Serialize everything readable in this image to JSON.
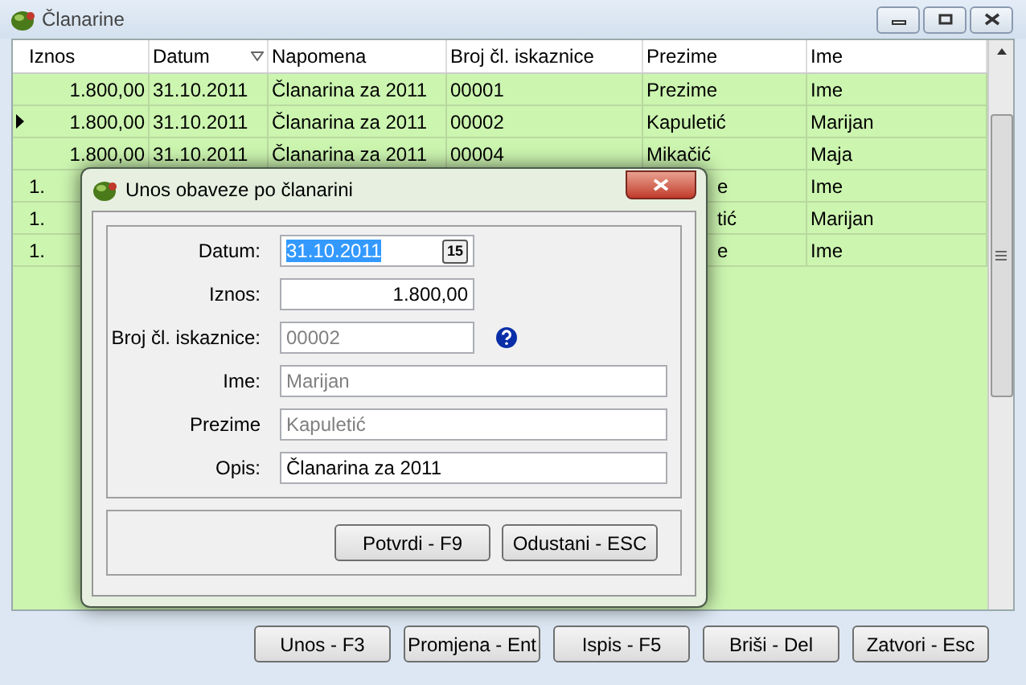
{
  "window": {
    "title": "Članarine"
  },
  "table": {
    "columns": [
      {
        "label": "Iznos",
        "sorted": false
      },
      {
        "label": "Datum",
        "sorted": true
      },
      {
        "label": "Napomena",
        "sorted": false
      },
      {
        "label": "Broj čl. iskaznice",
        "sorted": false
      },
      {
        "label": "Prezime",
        "sorted": false
      },
      {
        "label": "Ime",
        "sorted": false
      }
    ],
    "rows": [
      {
        "selected": false,
        "partial": false,
        "cells": [
          "1.800,00",
          "31.10.2011",
          "Članarina za 2011",
          "00001",
          "Prezime",
          "Ime"
        ]
      },
      {
        "selected": true,
        "partial": false,
        "cells": [
          "1.800,00",
          "31.10.2011",
          "Članarina za 2011",
          "00002",
          "Kapuletić",
          "Marijan"
        ]
      },
      {
        "selected": false,
        "partial": false,
        "cells": [
          "1.800,00",
          "31.10.2011",
          "Članarina za 2011",
          "00004",
          "Mikačić",
          "Maja"
        ]
      },
      {
        "selected": false,
        "partial": true,
        "cells": [
          "1.",
          "",
          "",
          "",
          "e",
          "Ime"
        ]
      },
      {
        "selected": false,
        "partial": true,
        "cells": [
          "1.",
          "",
          "",
          "",
          "tić",
          "Marijan"
        ]
      },
      {
        "selected": false,
        "partial": true,
        "cells": [
          "1.",
          "",
          "",
          "",
          "e",
          "Ime"
        ]
      }
    ]
  },
  "buttons": [
    "Unos - F3",
    "Promjena - Ent",
    "Ispis - F5",
    "Briši - Del",
    "Zatvori - Esc"
  ],
  "dialog": {
    "title": "Unos obaveze po članarini",
    "fields": [
      {
        "label": "Datum:",
        "value": "31.10.2011",
        "kind": "date",
        "disabled": false
      },
      {
        "label": "Iznos:",
        "value": "1.800,00",
        "kind": "amount",
        "disabled": false
      },
      {
        "label": "Broj čl. iskaznice:",
        "value": "00002",
        "kind": "lookup",
        "disabled": true
      },
      {
        "label": "Ime:",
        "value": "Marijan",
        "kind": "text",
        "disabled": true
      },
      {
        "label": "Prezime",
        "value": "Kapuletić",
        "kind": "text",
        "disabled": true
      },
      {
        "label": "Opis:",
        "value": "Članarina za 2011",
        "kind": "text",
        "disabled": false
      }
    ],
    "buttons": [
      "Potvrdi - F9",
      "Odustani - ESC"
    ],
    "calendar_icon_text": "15"
  }
}
